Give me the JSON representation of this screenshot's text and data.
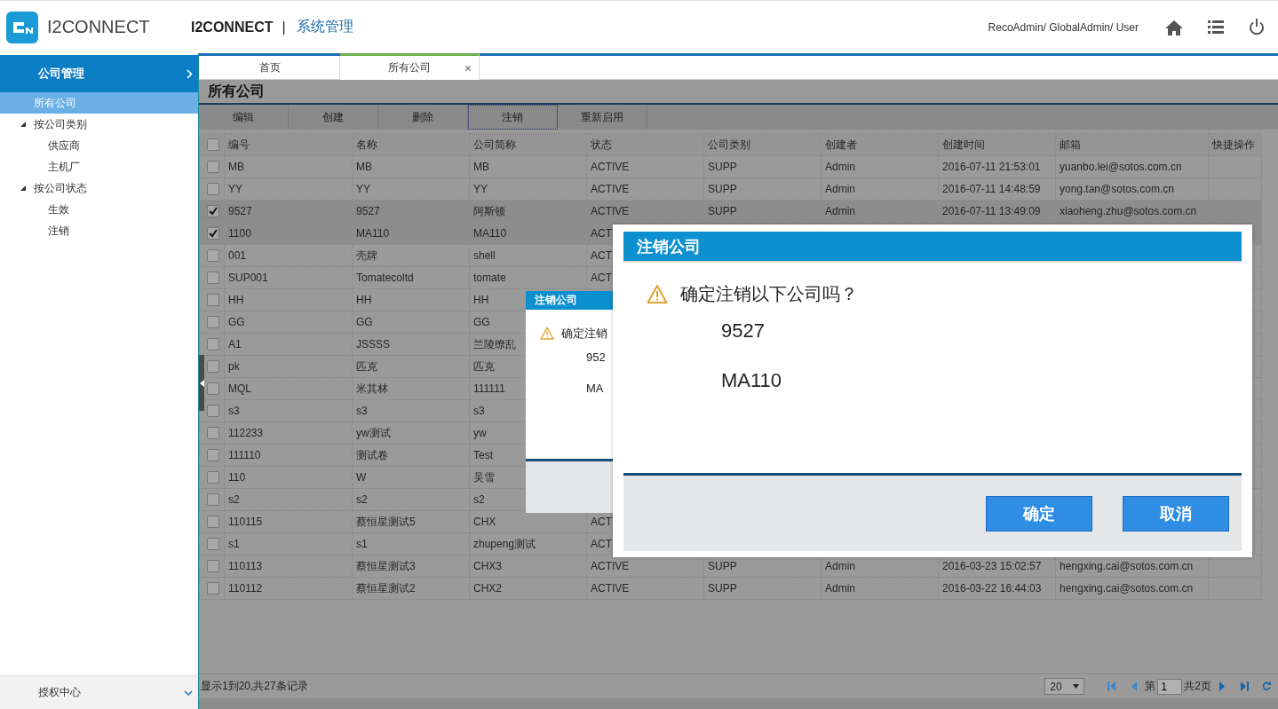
{
  "header": {
    "logo_text": "I2CONNECT",
    "app_name": "I2CONNECT",
    "separator": "|",
    "module": "系统管理",
    "user": "RecoAdmin/ GlobalAdmin/ User"
  },
  "sidebar": {
    "section": "公司管理",
    "items": [
      {
        "label": "所有公司",
        "selected": true
      },
      {
        "label": "按公司类别",
        "selected": false,
        "expanded": true,
        "children": [
          {
            "label": "供应商",
            "selected": false
          },
          {
            "label": "主机厂",
            "selected": false
          }
        ]
      },
      {
        "label": "按公司状态",
        "selected": false,
        "expanded": true,
        "children": [
          {
            "label": "生效",
            "selected": false
          },
          {
            "label": "注销",
            "selected": false
          }
        ]
      }
    ],
    "footer": "授权中心"
  },
  "tabs": [
    {
      "label": "首页",
      "selected": false
    },
    {
      "label": "所有公司",
      "selected": true,
      "close": "×"
    }
  ],
  "page_title": "所有公司",
  "toolbar": [
    {
      "label": "编辑",
      "focused": false
    },
    {
      "label": "创建",
      "focused": false
    },
    {
      "label": "删除",
      "focused": false
    },
    {
      "label": "注销",
      "focused": true
    },
    {
      "label": "重新启用",
      "focused": false
    }
  ],
  "table": {
    "select_all": {
      "checked": false
    },
    "columns": [
      "编号",
      "名称",
      "公司简称",
      "状态",
      "公司类别",
      "创建者",
      "创建时间",
      "邮箱",
      "快捷操作"
    ],
    "rows": [
      {
        "checked": false,
        "cells": [
          "MB",
          "MB",
          "MB",
          "ACTIVE",
          "SUPP",
          "Admin",
          "2016-07-11 21:53:01",
          "yuanbo.lei@sotos.com.cn"
        ]
      },
      {
        "checked": false,
        "cells": [
          "YY",
          "YY",
          "YY",
          "ACTIVE",
          "SUPP",
          "Admin",
          "2016-07-11 14:48:59",
          "yong.tan@sotos.com.cn"
        ]
      },
      {
        "checked": true,
        "cells": [
          "9527",
          "9527",
          "阿斯顿",
          "ACTIVE",
          "SUPP",
          "Admin",
          "2016-07-11 13:49:09",
          "xiaoheng.zhu@sotos.com.cn"
        ]
      },
      {
        "checked": true,
        "cells": [
          "1100",
          "MA110",
          "MA110",
          "ACT",
          null,
          null,
          null,
          null
        ]
      },
      {
        "checked": false,
        "cells": [
          "001",
          "壳牌",
          "shell",
          "ACT",
          null,
          null,
          null,
          null
        ]
      },
      {
        "checked": false,
        "cells": [
          "SUP001",
          "Tomatecoltd",
          "tomate",
          "ACT",
          null,
          null,
          null,
          null
        ]
      },
      {
        "checked": false,
        "cells": [
          "HH",
          "HH",
          "HH",
          null,
          null,
          null,
          null,
          null
        ]
      },
      {
        "checked": false,
        "cells": [
          "GG",
          "GG",
          "GG",
          null,
          null,
          null,
          null,
          null
        ]
      },
      {
        "checked": false,
        "cells": [
          "A1",
          "JSSSS",
          "兰陵缭乱",
          null,
          null,
          null,
          null,
          null
        ]
      },
      {
        "checked": false,
        "cells": [
          "pk",
          "匹克",
          "匹克",
          null,
          null,
          null,
          null,
          null
        ]
      },
      {
        "checked": false,
        "cells": [
          "MQL",
          "米其林",
          "111111",
          null,
          null,
          null,
          null,
          null
        ]
      },
      {
        "checked": false,
        "cells": [
          "s3",
          "s3",
          "s3",
          null,
          null,
          null,
          null,
          null
        ]
      },
      {
        "checked": false,
        "cells": [
          "112233",
          "yw测试",
          "yw",
          null,
          null,
          null,
          null,
          null
        ]
      },
      {
        "checked": false,
        "cells": [
          "111110",
          "测试卷",
          "Test",
          null,
          null,
          null,
          null,
          null
        ]
      },
      {
        "checked": false,
        "cells": [
          "110",
          "W",
          "吴雪",
          null,
          null,
          null,
          null,
          null
        ]
      },
      {
        "checked": false,
        "cells": [
          "s2",
          "s2",
          "s2",
          null,
          null,
          null,
          null,
          null
        ]
      },
      {
        "checked": false,
        "cells": [
          "110115",
          "蔡恒星测试5",
          "CHX",
          "ACT",
          null,
          null,
          null,
          null
        ]
      },
      {
        "checked": false,
        "cells": [
          "s1",
          "s1",
          "zhupeng测试",
          "ACT",
          null,
          null,
          null,
          null
        ]
      },
      {
        "checked": false,
        "cells": [
          "110113",
          "蔡恒星测试3",
          "CHX3",
          "ACTIVE",
          "SUPP",
          "Admin",
          "2016-03-23 15:02:57",
          "hengxing.cai@sotos.com.cn"
        ]
      },
      {
        "checked": false,
        "cells": [
          "110112",
          "蔡恒星测试2",
          "CHX2",
          "ACTIVE",
          "SUPP",
          "Admin",
          "2016-03-22 16:44:03",
          "hengxing.cai@sotos.com.cn"
        ]
      }
    ]
  },
  "pager": {
    "summary": "显示1到20,共27条记录",
    "page_size": "20",
    "page_prefix": "第",
    "page": "1",
    "page_suffix": "共2页"
  },
  "dialogs": [
    {
      "kind": "small",
      "title": "注销公司",
      "message": "确定注销",
      "items": [
        "952",
        "MA"
      ]
    },
    {
      "kind": "large",
      "title": "注销公司",
      "message": "确定注销以下公司吗？",
      "items": [
        "9527",
        "MA110"
      ],
      "buttons": [
        "确定",
        "取消"
      ]
    }
  ]
}
